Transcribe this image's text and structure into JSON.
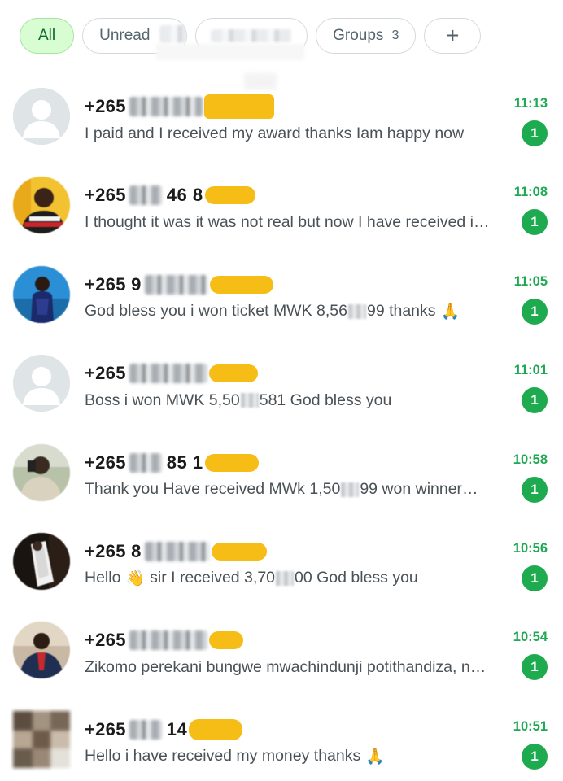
{
  "filters": {
    "all": "All",
    "unread": "Unread",
    "groups": "Groups",
    "groups_count": "3",
    "add": "+"
  },
  "colors": {
    "accent_green": "#1eaa4f",
    "chip_active_bg": "#d9fdd3",
    "redaction_yellow": "#f6bd16"
  },
  "chats": [
    {
      "phone": "+265",
      "digits": "",
      "preview_parts": [
        "I paid and I received my award thanks Iam happy now"
      ],
      "time": "11:13",
      "unread": "1",
      "avatar": "default-avatar-icon"
    },
    {
      "phone": "+265",
      "digits": "46 8",
      "preview_parts": [
        "I thought it was it was not real but now I have received i…"
      ],
      "time": "11:08",
      "unread": "1",
      "avatar": "profile-photo"
    },
    {
      "phone": "+265 9",
      "digits": "",
      "preview_parts": [
        "God bless you i won ticket MWK 8,56",
        "99 thanks"
      ],
      "time": "11:05",
      "unread": "1",
      "avatar": "profile-photo",
      "emoji": "folded-hands-emoji"
    },
    {
      "phone": "+265",
      "digits": "",
      "preview_parts": [
        "Boss i won MWK 5,50",
        "581 God bless you"
      ],
      "time": "11:01",
      "unread": "1",
      "avatar": "default-avatar-icon"
    },
    {
      "phone": "+265",
      "digits": "85 1",
      "preview_parts": [
        "Thank you Have received MWk 1,50",
        "99 won winner…"
      ],
      "time": "10:58",
      "unread": "1",
      "avatar": "profile-photo"
    },
    {
      "phone": "+265 8",
      "digits": "",
      "preview_parts": [
        "Hello",
        "sir I received 3,70",
        "00 God bless you"
      ],
      "time": "10:56",
      "unread": "1",
      "avatar": "profile-photo",
      "emoji": "waving-hand-emoji"
    },
    {
      "phone": "+265",
      "digits": "",
      "preview_parts": [
        "Zikomo perekani bungwe mwachindunji potithandiza, n…"
      ],
      "time": "10:54",
      "unread": "1",
      "avatar": "profile-photo"
    },
    {
      "phone": "+265",
      "digits": "14",
      "preview_parts": [
        "Hello i have received my money thanks"
      ],
      "time": "10:51",
      "unread": "1",
      "avatar": "profile-photo",
      "emoji": "folded-hands-emoji"
    }
  ]
}
